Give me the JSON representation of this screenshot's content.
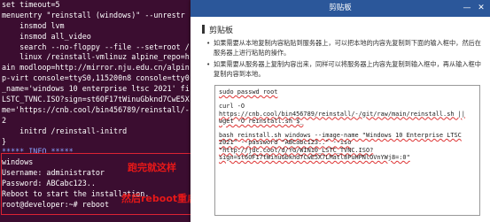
{
  "terminal": {
    "lines": [
      "set timeout=5",
      "menuentry \"reinstall (windows)\" --unrestr",
      "    insmod lvm",
      "    insmod all_video",
      "    search --no-floppy --file --set=root /",
      "    linux /reinstall-vmlinuz alpine_repo=h",
      "ain modloop=http://mirror.nju.edu.cn/alpin",
      "p-virt console=ttyS0,115200n8 console=tty0",
      "_name='windows 10 enterprise ltsc 2021' fi",
      "LSTC_TVNC.ISO?sign=st6OF17tWinuGbknd7CwE5X",
      "me='https://cnb.cool/bin456789/reinstall/-",
      "2",
      "    initrd /reinstall-initrd",
      "}",
      "***** INFO *****",
      "windows",
      "Username: administrator",
      "Password: ABCabc123..",
      "Reboot to start the installation.",
      "root@developer:~# reboot"
    ],
    "info_line_index": 14,
    "prompt_line_index": 19
  },
  "annotations": {
    "success_note": "跑完就这样",
    "reboot_note": "然后reboot重启"
  },
  "dialog": {
    "title": "剪贴板",
    "minimize": "—",
    "close": "✕",
    "heading": "剪贴板",
    "bullets": [
      "如果需要从本地复制内容粘贴到服务器上，可以把本地的内容先复制到下面的输入框中，然后在服务器上进行粘贴的操作。",
      "如果需要从服务器上复制内容出来，同样可以将服务器上内容先复制到输入框中，再从输入框中复制内容到本地。"
    ],
    "clipboard_lines": [
      "sudo passwd root",
      "",
      "curl -O",
      "https://cnb.cool/bin456789/reinstall/-/git/raw/main/reinstall.sh ||",
      "wget -O reinstall.sh $_",
      "",
      "bash reinstall.sh windows --image-name \"Windows 10 Enterprise LTSC",
      "2021\" --password \"ABCabc123..\" --iso",
      "\"http://jdc.cool/d/YG/WIN10_LSTC_TVNC.ISO?",
      "sign=st6OF17tWinuGbknd7CwE5X7LMatl8PuHPNlOVnYWj8=:0\""
    ],
    "squiggle_lines": [
      0,
      3,
      4,
      6,
      7,
      8,
      9
    ]
  }
}
